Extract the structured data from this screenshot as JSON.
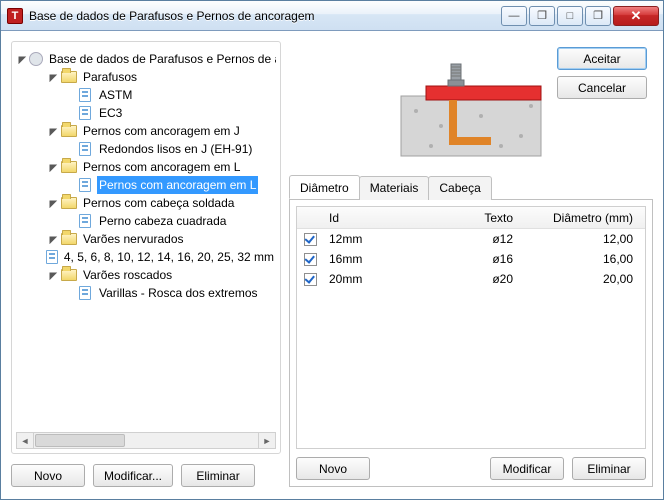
{
  "window": {
    "title": "Base de dados de Parafusos e Pernos de ancoragem"
  },
  "titlebar_controls": {
    "min": "—",
    "restore1": "❐",
    "restore2": "□",
    "restore3": "❐",
    "close": "✕"
  },
  "actions": {
    "accept": "Aceitar",
    "cancel": "Cancelar"
  },
  "tree": {
    "root": "Base de dados de Parafusos e Pernos de anco",
    "nodes": [
      {
        "label": "Parafusos",
        "type": "folder",
        "level": 1
      },
      {
        "label": "ASTM",
        "type": "doc",
        "level": 2
      },
      {
        "label": "EC3",
        "type": "doc",
        "level": 2
      },
      {
        "label": "Pernos com ancoragem em J",
        "type": "folder",
        "level": 1
      },
      {
        "label": "Redondos lisos en J (EH-91)",
        "type": "doc",
        "level": 2
      },
      {
        "label": "Pernos com ancoragem em L",
        "type": "folder",
        "level": 1
      },
      {
        "label": "Pernos com ancoragem em L",
        "type": "doc",
        "level": 2,
        "selected": true
      },
      {
        "label": "Pernos com cabeça soldada",
        "type": "folder",
        "level": 1
      },
      {
        "label": "Perno cabeza cuadrada",
        "type": "doc",
        "level": 2
      },
      {
        "label": "Varões nervurados",
        "type": "folder",
        "level": 1
      },
      {
        "label": "4, 5, 6, 8, 10, 12, 14, 16, 20, 25, 32 mm",
        "type": "doc",
        "level": 2
      },
      {
        "label": "Varões roscados",
        "type": "folder",
        "level": 1
      },
      {
        "label": "Varillas - Rosca dos extremos",
        "type": "doc",
        "level": 2
      }
    ]
  },
  "left_buttons": {
    "new": "Novo",
    "modify": "Modificar...",
    "delete": "Eliminar"
  },
  "tabs": {
    "diameter": "Diâmetro",
    "materials": "Materiais",
    "head": "Cabeça"
  },
  "table": {
    "headers": {
      "id": "Id",
      "text": "Texto",
      "diameter": "Diâmetro (mm)"
    },
    "rows": [
      {
        "checked": true,
        "id": "12mm",
        "text": "ø12",
        "diameter": "12,00"
      },
      {
        "checked": true,
        "id": "16mm",
        "text": "ø16",
        "diameter": "16,00"
      },
      {
        "checked": true,
        "id": "20mm",
        "text": "ø20",
        "diameter": "20,00"
      }
    ]
  },
  "tab_buttons": {
    "new": "Novo",
    "modify": "Modificar",
    "delete": "Eliminar"
  }
}
